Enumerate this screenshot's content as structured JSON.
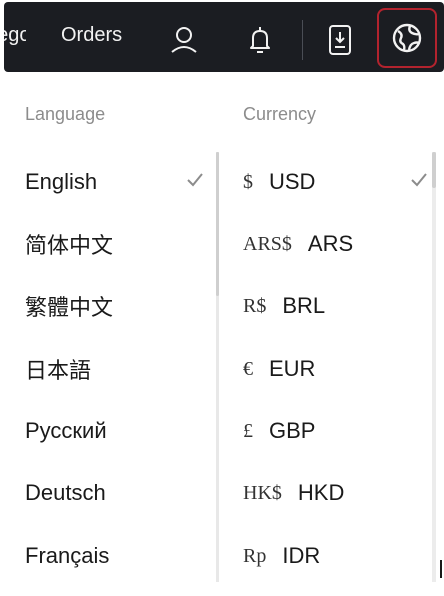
{
  "nav": {
    "prev_item_label": "Categories",
    "orders_label": "Orders",
    "icons": [
      "user-icon",
      "bell-icon",
      "download-app-icon",
      "globe-icon"
    ]
  },
  "language": {
    "heading": "Language",
    "selected": "English",
    "items": [
      {
        "label": "English",
        "selected": true
      },
      {
        "label": "简体中文"
      },
      {
        "label": "繁體中文"
      },
      {
        "label": "日本語"
      },
      {
        "label": "Русский"
      },
      {
        "label": "Deutsch"
      },
      {
        "label": "Français"
      }
    ]
  },
  "currency": {
    "heading": "Currency",
    "selected": "USD",
    "items": [
      {
        "symbol": "$",
        "code": "USD",
        "selected": true
      },
      {
        "symbol": "ARS$",
        "code": "ARS"
      },
      {
        "symbol": "R$",
        "code": "BRL"
      },
      {
        "symbol": "€",
        "code": "EUR"
      },
      {
        "symbol": "£",
        "code": "GBP"
      },
      {
        "symbol": "HK$",
        "code": "HKD"
      },
      {
        "symbol": "Rp",
        "code": "IDR"
      }
    ]
  },
  "colors": {
    "topbar": "#1b1d22",
    "accent_border": "#b3232e",
    "check": "#8c8c8c"
  }
}
